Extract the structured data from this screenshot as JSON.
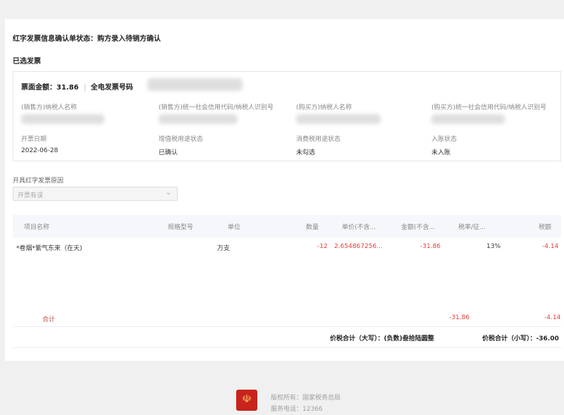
{
  "status": {
    "label": "红字发票信息确认单状态：",
    "value": "购方录入待销方确认"
  },
  "selected_invoice": {
    "section_title": "已选发票",
    "amount_label": "票面金额：",
    "amount": "31.86",
    "invoice_no_label": "全电发票号码"
  },
  "info": {
    "seller_name_label": "(销售方)纳税人名称",
    "seller_id_label": "(销售方)统一社会信用代码/纳税人识别号",
    "buyer_name_label": "(购买方)纳税人名称",
    "buyer_id_label": "(购买方)统一社会信用代码/纳税人识别号",
    "date_label": "开票日期",
    "date_value": "2022-06-28",
    "vat_status_label": "增值税用途状态",
    "vat_status_value": "已确认",
    "consumption_status_label": "消费税用途状态",
    "consumption_status_value": "未勾选",
    "entry_status_label": "入账状态",
    "entry_status_value": "未入账"
  },
  "reason": {
    "label": "开具红字发票原因",
    "selected": "开票有误"
  },
  "table": {
    "headers": [
      "项目名称",
      "规格型号",
      "单位",
      "数量",
      "单价(不含...",
      "金额(不含...",
      "税率/征...",
      "税额"
    ],
    "rows": [
      {
        "name": "*卷烟*紫气东来（在天)",
        "spec": "",
        "unit": "万支",
        "qty": "-12",
        "price": "2.654867256...",
        "amount": "-31.86",
        "rate": "13%",
        "tax": "-4.14"
      }
    ],
    "sum_label": "合计",
    "sum_amount": "-31.86",
    "sum_tax": "-4.14"
  },
  "totals": {
    "upper_label": "价税合计（大写）：",
    "upper_value": "(负数)叁拾陆圆整",
    "lower_label": "价税合计（小写）：",
    "lower_value": "-36.00"
  },
  "footer": {
    "copyright": "版权所有：国家税务总局",
    "phone": "服务电话：12366"
  },
  "colors": {
    "negative": "#e6413c",
    "logo_red": "#c8231c"
  }
}
